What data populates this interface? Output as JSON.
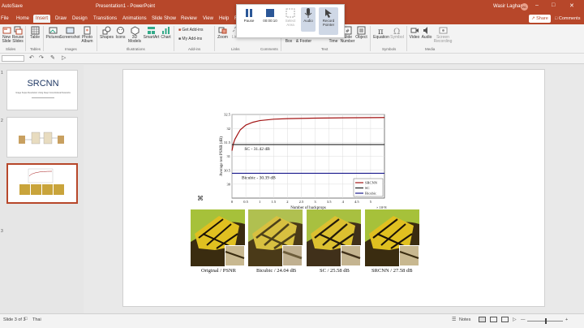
{
  "window": {
    "doc_title": "Presentation1 - PowerPoint",
    "user": "Wasir Laghan",
    "user_initials": "WL",
    "autosave": "AutoSave"
  },
  "menu_tabs": [
    "File",
    "Home",
    "Insert",
    "Draw",
    "Design",
    "Transitions",
    "Animations",
    "Slide Show",
    "Review",
    "View",
    "Help",
    "Re"
  ],
  "active_tab": "Insert",
  "share_label": "Share",
  "comments_label": "Comments",
  "ribbon": {
    "groups": [
      "Slides",
      "Tables",
      "Images",
      "Illustrations",
      "Add-ins",
      "Links",
      "Comments",
      "Text",
      "Symbols",
      "Media"
    ],
    "buttons": {
      "new_slide": "New Slide",
      "reuse": "Reuse Slides",
      "table": "Table",
      "pictures": "Pictures",
      "screenshot": "Screenshot",
      "photo_album": "Photo Album",
      "shapes": "Shapes",
      "icons": "Icons",
      "models": "3D Models",
      "smartart": "SmartArt",
      "chart": "Chart",
      "get_addins": "Get Add-ins",
      "my_addins": "My Add-ins",
      "zoom": "Zoom",
      "link": "Link",
      "action": "Action",
      "comment": "Comment",
      "textbox": "Text Box",
      "header_footer": "Header & Footer",
      "wordart": "WordArt",
      "date_time": "Date & Time",
      "slide_number": "Slide Number",
      "object": "Object",
      "equation": "Equation",
      "symbol": "Symbol",
      "video": "Video",
      "audio": "Audio",
      "screen_recording": "Screen Recording"
    }
  },
  "recording_popup": {
    "pause": "Pause",
    "time": "00:00:10",
    "select_area": "Select Area",
    "audio": "Audio",
    "record_pointer": "Record Pointer"
  },
  "thumbs": [
    {
      "num": "1",
      "title": "SRCNN",
      "subtitle": "Image Super-Resolution Using Deep Convolutional Networks"
    },
    {
      "num": "2"
    },
    {
      "num": "3"
    }
  ],
  "chart_data": {
    "type": "line",
    "ylabel": "Average test PSNR (dB)",
    "xlabel": "Number of backprops",
    "x_multiplier": "× 10^8",
    "xlim": [
      0,
      5.5
    ],
    "ylim": [
      29.5,
      32.5
    ],
    "xticks": [
      "0",
      "0.5",
      "1",
      "1.5",
      "2",
      "2.5",
      "3",
      "3.5",
      "4",
      "4.5",
      "5"
    ],
    "yticks": [
      "30",
      "30.5",
      "31",
      "31.5",
      "32",
      "32.5"
    ],
    "grid": true,
    "legend_position": "bottom-right",
    "series": [
      {
        "name": "SRCNN",
        "color": "#a31515",
        "x": [
          0,
          0.05,
          0.1,
          0.2,
          0.3,
          0.5,
          0.75,
          1,
          1.5,
          2,
          3,
          4,
          5.5
        ],
        "y": [
          31.2,
          31.45,
          31.6,
          31.78,
          31.95,
          32.12,
          32.22,
          32.28,
          32.33,
          32.35,
          32.37,
          32.38,
          32.39
        ]
      },
      {
        "name": "SC",
        "color": "#222222",
        "x": [
          0,
          5.5
        ],
        "y": [
          31.42,
          31.42
        ]
      },
      {
        "name": "Bicubic",
        "color": "#1a1a8c",
        "x": [
          0,
          5.5
        ],
        "y": [
          30.39,
          30.39
        ]
      }
    ],
    "annotations": [
      "SC - 31.42 dB",
      "Bicubic - 30.39 dB"
    ]
  },
  "comparison_labels": [
    "Original / PSNR",
    "Bicubic / 24.04 dB",
    "SC / 25.58 dB",
    "SRCNN / 27.58 dB"
  ],
  "status": {
    "slide_info": "Slide 3 of 3",
    "language": "Thai",
    "notes": "Notes",
    "zoom": "—"
  }
}
